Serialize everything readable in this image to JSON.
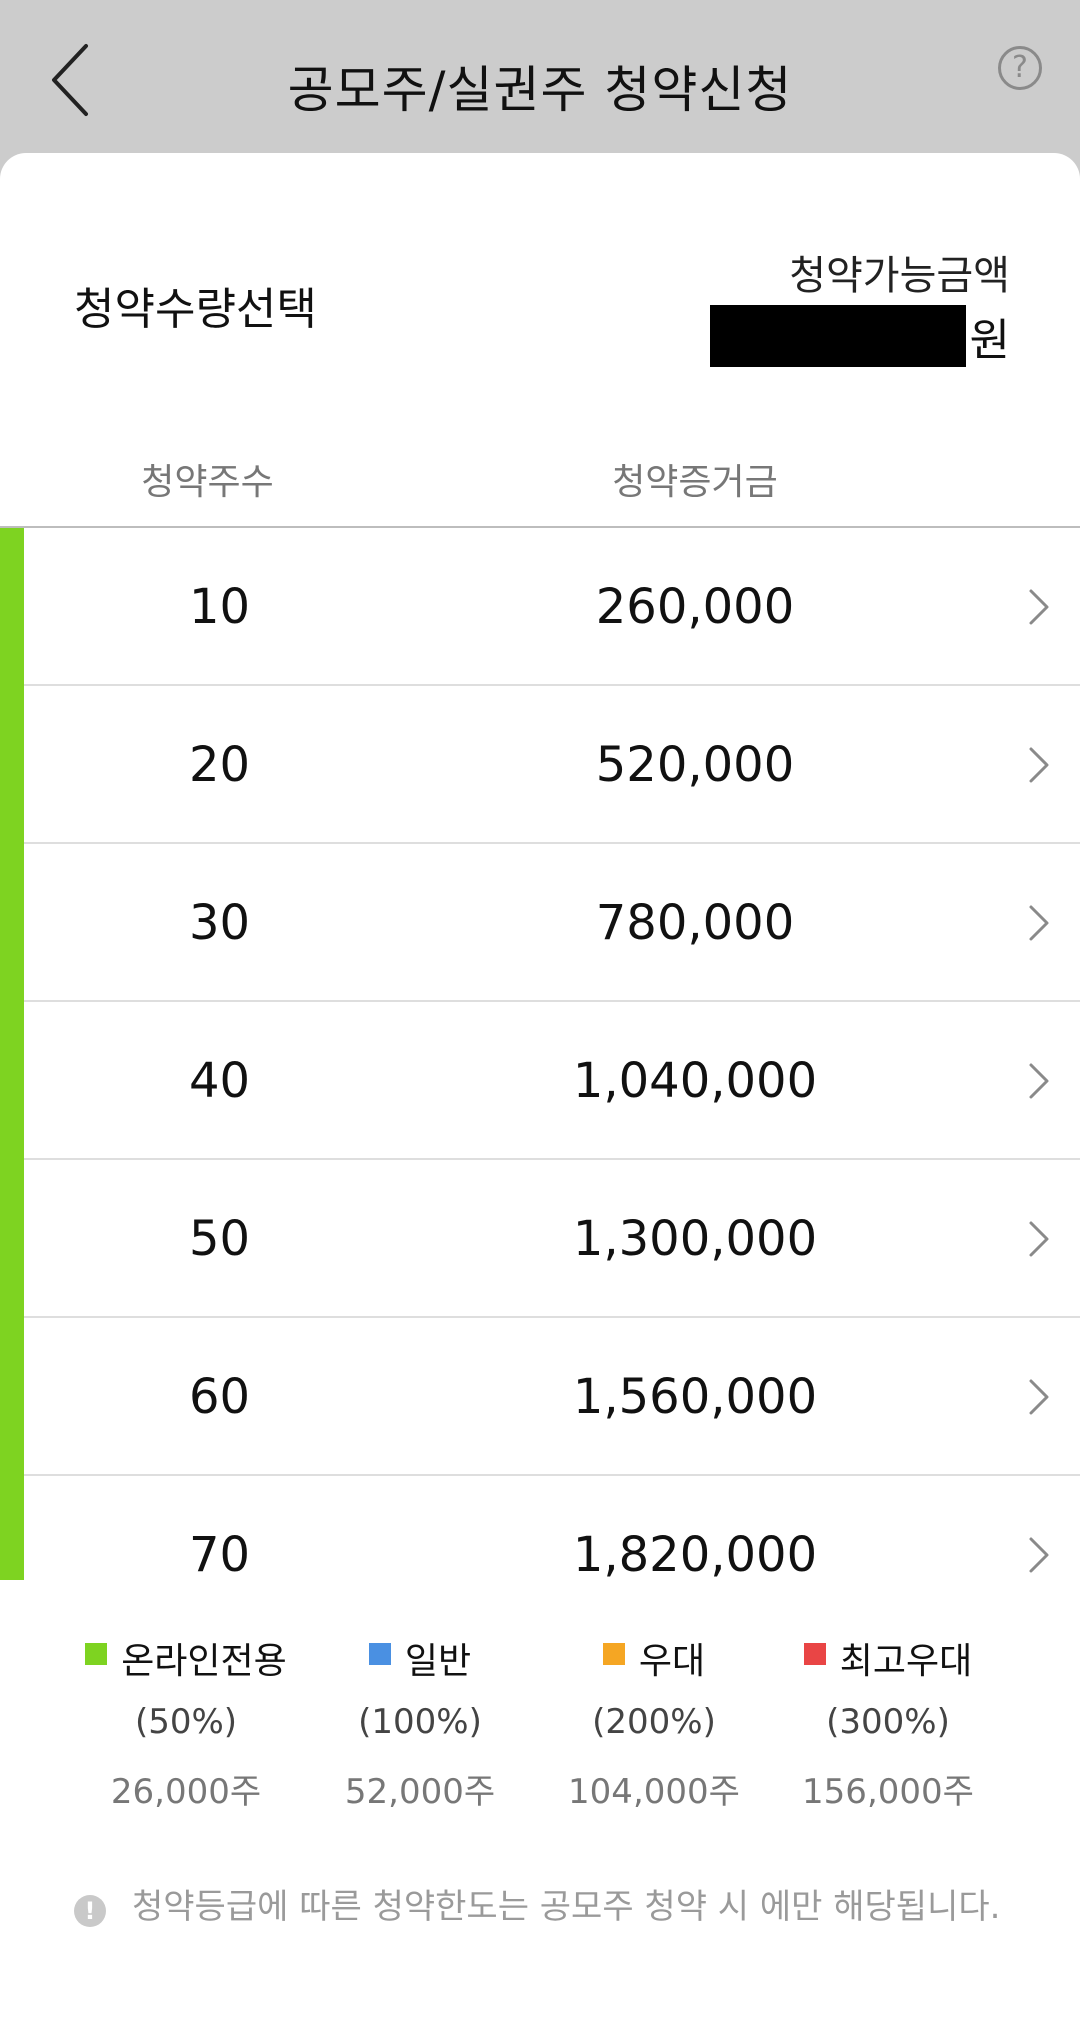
{
  "header": {
    "title": "공모주/실권주 청약신청",
    "help_symbol": "?"
  },
  "summary": {
    "select_label": "청약수량선택",
    "available_label": "청약가능금액",
    "currency": "원"
  },
  "table": {
    "columns": [
      "청약주수",
      "청약증거금"
    ],
    "rows": [
      {
        "shares": "10",
        "deposit": "260,000"
      },
      {
        "shares": "20",
        "deposit": "520,000"
      },
      {
        "shares": "30",
        "deposit": "780,000"
      },
      {
        "shares": "40",
        "deposit": "1,040,000"
      },
      {
        "shares": "50",
        "deposit": "1,300,000"
      },
      {
        "shares": "60",
        "deposit": "1,560,000"
      },
      {
        "shares": "70",
        "deposit": "1,820,000"
      }
    ]
  },
  "legend": [
    {
      "label": "온라인전용",
      "percent": "(50%)",
      "shares": "26,000주",
      "color": "#7ed321"
    },
    {
      "label": "일반",
      "percent": "(100%)",
      "shares": "52,000주",
      "color": "#4a90e2"
    },
    {
      "label": "우대",
      "percent": "(200%)",
      "shares": "104,000주",
      "color": "#f5a623"
    },
    {
      "label": "최고우대",
      "percent": "(300%)",
      "shares": "156,000주",
      "color": "#e94545"
    }
  ],
  "notice": {
    "icon_symbol": "!",
    "text": "청약등급에 따른 청약한도는 공모주 청약 시 에만 해당됩니다."
  },
  "colors": {
    "accent_green": "#7ed321",
    "header_bg": "#cccccc"
  }
}
